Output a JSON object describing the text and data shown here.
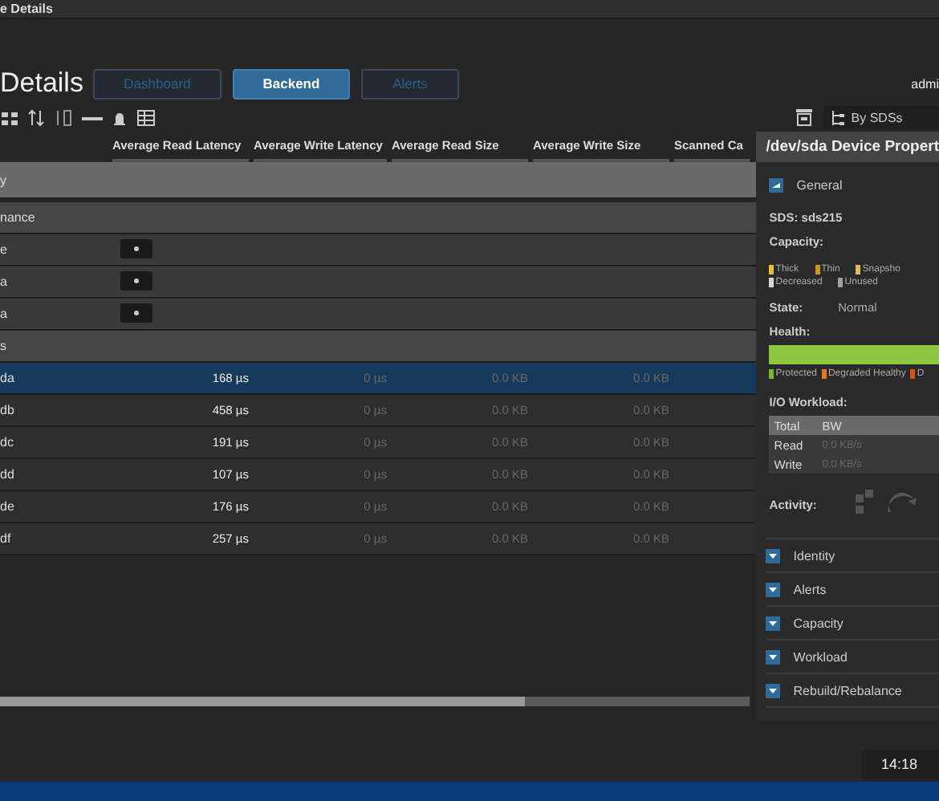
{
  "window": {
    "title": "e Details"
  },
  "header": {
    "title": "Details",
    "user": "admi"
  },
  "tabs": [
    {
      "label": "Dashboard",
      "selected": false
    },
    {
      "label": "Backend",
      "selected": true
    },
    {
      "label": "Alerts",
      "selected": false
    }
  ],
  "view_selector": {
    "value": "By SDSs"
  },
  "table": {
    "columns": [
      "Average Read Latency",
      "Average Write Latency",
      "Average Read Size",
      "Average Write Size",
      "Scanned Ca"
    ],
    "rows": [
      {
        "kind": "top",
        "name": "y",
        "cells": []
      },
      {
        "kind": "group",
        "name": "nance",
        "cells": []
      },
      {
        "kind": "badge",
        "name": "e",
        "cells": []
      },
      {
        "kind": "badge",
        "name": "a",
        "cells": []
      },
      {
        "kind": "badge",
        "name": "a",
        "cells": []
      },
      {
        "kind": "group",
        "name": "s",
        "cells": []
      },
      {
        "kind": "device",
        "name": "da",
        "selected": true,
        "cells": [
          "168 µs",
          "0 µs",
          "0.0 KB",
          "0.0 KB"
        ]
      },
      {
        "kind": "device",
        "name": "db",
        "selected": false,
        "cells": [
          "458 µs",
          "0 µs",
          "0.0 KB",
          "0.0 KB"
        ]
      },
      {
        "kind": "device",
        "name": "dc",
        "selected": false,
        "cells": [
          "191 µs",
          "0 µs",
          "0.0 KB",
          "0.0 KB"
        ]
      },
      {
        "kind": "device",
        "name": "dd",
        "selected": false,
        "cells": [
          "107 µs",
          "0 µs",
          "0.0 KB",
          "0.0 KB"
        ]
      },
      {
        "kind": "device",
        "name": "de",
        "selected": false,
        "cells": [
          "176 µs",
          "0 µs",
          "0.0 KB",
          "0.0 KB"
        ]
      },
      {
        "kind": "device",
        "name": "df",
        "selected": false,
        "cells": [
          "257 µs",
          "0 µs",
          "0.0 KB",
          "0.0 KB"
        ]
      }
    ]
  },
  "properties": {
    "title": "/dev/sda Device Propert",
    "general": {
      "label": "General",
      "expanded": true,
      "sds": "SDS: sds215",
      "capacity_label": "Capacity:",
      "capacity_legend": [
        {
          "label": "Thick",
          "color": "#e8c020"
        },
        {
          "label": "Thin",
          "color": "#c89a20"
        },
        {
          "label": "Snapsho",
          "color": "#e0b860"
        },
        {
          "label": "Decreased",
          "color": "#d8d8d8"
        },
        {
          "label": "Unused",
          "color": "#a0a0a0"
        }
      ],
      "state_label": "State:",
      "state": "Normal",
      "health_label": "Health:",
      "health": {
        "level": 1
      },
      "health_legend": [
        {
          "label": "Protected",
          "color": "#7ab828"
        },
        {
          "label": "Degraded Healthy",
          "color": "#e87820"
        },
        {
          "label": "D",
          "color": "#e05010"
        }
      ],
      "workload_label": "I/O Workload:",
      "workload_header": [
        "Total",
        "BW"
      ],
      "workload_rows": [
        [
          "Read",
          "0.0 KB/s"
        ],
        [
          "Write",
          "0.0 KB/s"
        ]
      ],
      "activity_label": "Activity:"
    },
    "sections": [
      {
        "label": "Identity",
        "expanded": false
      },
      {
        "label": "Alerts",
        "expanded": false
      },
      {
        "label": "Capacity",
        "expanded": false
      },
      {
        "label": "Workload",
        "expanded": false
      },
      {
        "label": "Rebuild/Rebalance",
        "expanded": false
      }
    ]
  },
  "status_bar": {
    "time": "14:18"
  }
}
